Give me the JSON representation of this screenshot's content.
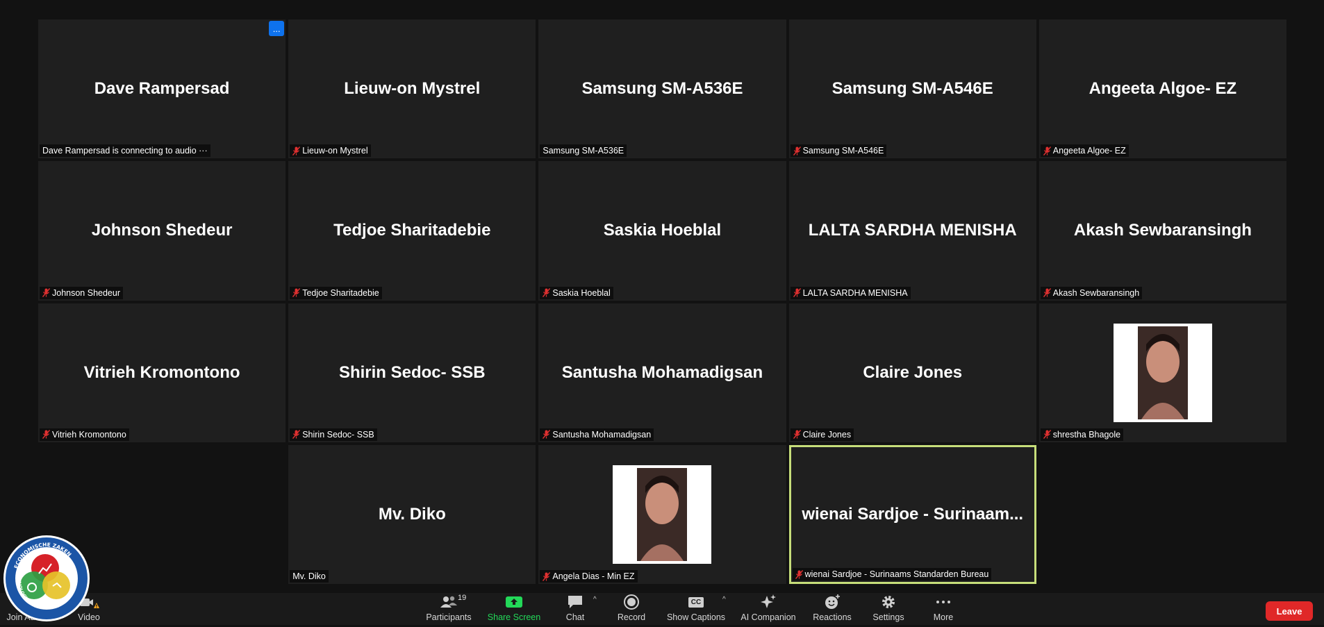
{
  "tiles": [
    {
      "name": "Dave Rampersad",
      "label": "Dave Rampersad is connecting to audio ···",
      "muted": false,
      "badge": "..."
    },
    {
      "name": "Lieuw-on Mystrel",
      "label": "Lieuw-on Mystrel",
      "muted": true
    },
    {
      "name": "Samsung SM-A536E",
      "label": "Samsung SM-A536E",
      "muted": false
    },
    {
      "name": "Samsung SM-A546E",
      "label": "Samsung SM-A546E",
      "muted": true
    },
    {
      "name": "Angeeta Algoe- EZ",
      "label": "Angeeta Algoe- EZ",
      "muted": true
    },
    {
      "name": "Johnson Shedeur",
      "label": "Johnson Shedeur",
      "muted": true
    },
    {
      "name": "Tedjoe Sharitadebie",
      "label": "Tedjoe Sharitadebie",
      "muted": true
    },
    {
      "name": "Saskia Hoeblal",
      "label": "Saskia Hoeblal",
      "muted": true
    },
    {
      "name": "LALTA SARDHA MENISHA",
      "label": "LALTA SARDHA MENISHA",
      "muted": true
    },
    {
      "name": "Akash Sewbaransingh",
      "label": "Akash Sewbaransingh",
      "muted": true
    },
    {
      "name": "Vitrieh Kromontono",
      "label": "Vitrieh Kromontono",
      "muted": true
    },
    {
      "name": "Shirin Sedoc- SSB",
      "label": "Shirin Sedoc- SSB",
      "muted": true
    },
    {
      "name": "Santusha Mohamadigsan",
      "label": "Santusha Mohamadigsan",
      "muted": true
    },
    {
      "name": "Claire Jones",
      "label": "Claire Jones",
      "muted": true
    },
    {
      "name": "",
      "label": "shrestha Bhagole",
      "muted": true,
      "photo": "portrait-photo"
    },
    {
      "empty": true
    },
    {
      "name": "Mv. Diko",
      "label": "Mv. Diko",
      "muted": false
    },
    {
      "name": "",
      "label": "Angela Dias - Min EZ",
      "muted": true,
      "photo": "portrait-photo"
    },
    {
      "name": "wienai Sardjoe - Surinaam...",
      "label": "wienai Sardjoe - Surinaams Standarden Bureau",
      "muted": true,
      "active": true
    },
    {
      "empty": true
    }
  ],
  "toolbar": {
    "join_audio": "Join Au",
    "video": "Video",
    "participants": "Participants",
    "participants_count": "19",
    "share_screen": "Share Screen",
    "chat": "Chat",
    "record": "Record",
    "show_captions": "Show Captions",
    "cc_text": "CC",
    "ai_companion": "AI Companion",
    "reactions": "Reactions",
    "settings": "Settings",
    "more": "More",
    "leave": "Leave"
  },
  "logo": {
    "text_top": "ECONOMISCHE ZAKEN",
    "text_left": "TECHNOLOGISCHE INNOVATIE",
    "text_right": "ONDERNEMERSCHAP"
  },
  "colors": {
    "active_border": "#c6de7a",
    "share_green": "#23d959",
    "leave_red": "#e02828",
    "badge_blue": "#0e72ed"
  }
}
